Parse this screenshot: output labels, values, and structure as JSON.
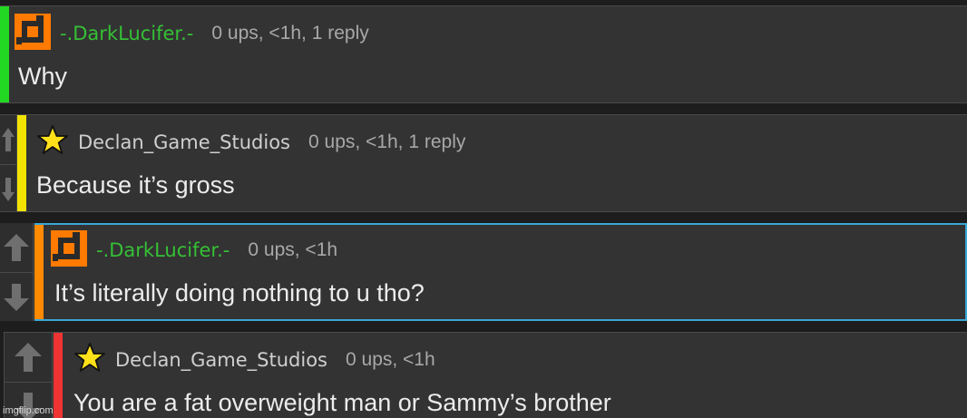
{
  "comments": [
    {
      "username": "-.DarkLucifer.-",
      "meta": "0 ups, <1h, 1 reply",
      "text": "Why",
      "accent_color": "#22d822",
      "icon": "orange-pixel-avatar-icon"
    },
    {
      "username": "Declan_Game_Studios",
      "meta": "0 ups, <1h, 1 reply",
      "text": "Because it’s gross",
      "accent_color": "#f2e400",
      "icon": "yellow-star-icon"
    },
    {
      "username": "-.DarkLucifer.-",
      "meta": "0 ups, <1h",
      "text": "It’s literally doing nothing to u tho?",
      "accent_color": "#ff8a00",
      "icon": "orange-pixel-avatar-icon"
    },
    {
      "username": "Declan_Game_Studios",
      "meta": "0 ups, <1h",
      "text": "You are a fat overweight man or Sammy’s brother",
      "accent_color": "#ee3333",
      "icon": "yellow-star-icon"
    }
  ],
  "colors": {
    "selection_border": "#3aa7d6",
    "mod_username": "#35c035",
    "panel_bg": "#333333"
  },
  "watermark": "imgflip.com"
}
